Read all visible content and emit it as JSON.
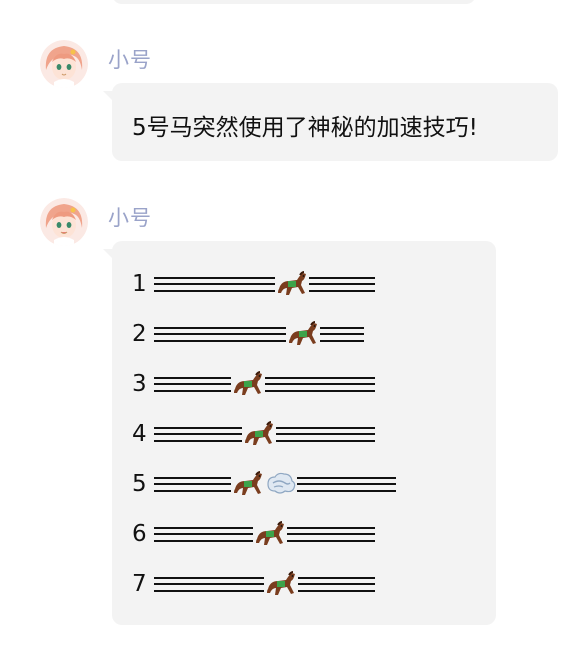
{
  "messages": [
    {
      "sender": "小号",
      "text": "5号马突然使用了神秘的加速技巧!"
    },
    {
      "sender": "小号",
      "lines": [
        {
          "lane": "1",
          "before": 11,
          "horse": true,
          "dash": false,
          "after": 6
        },
        {
          "lane": "2",
          "before": 12,
          "horse": true,
          "dash": false,
          "after": 4
        },
        {
          "lane": "3",
          "before": 7,
          "horse": true,
          "dash": false,
          "after": 10
        },
        {
          "lane": "4",
          "before": 8,
          "horse": true,
          "dash": false,
          "after": 9
        },
        {
          "lane": "5",
          "before": 7,
          "horse": true,
          "dash": true,
          "after": 9
        },
        {
          "lane": "6",
          "before": 9,
          "horse": true,
          "dash": false,
          "after": 8
        },
        {
          "lane": "7",
          "before": 10,
          "horse": true,
          "dash": false,
          "after": 7
        }
      ]
    }
  ],
  "icons": {
    "avatar": "anime-girl-avatar-icon",
    "horse": "racing-horse-icon",
    "dash": "dash-cloud-icon"
  },
  "colors": {
    "sender": "#9aa3c9",
    "bubble": "#f3f3f3",
    "text": "#111111"
  }
}
